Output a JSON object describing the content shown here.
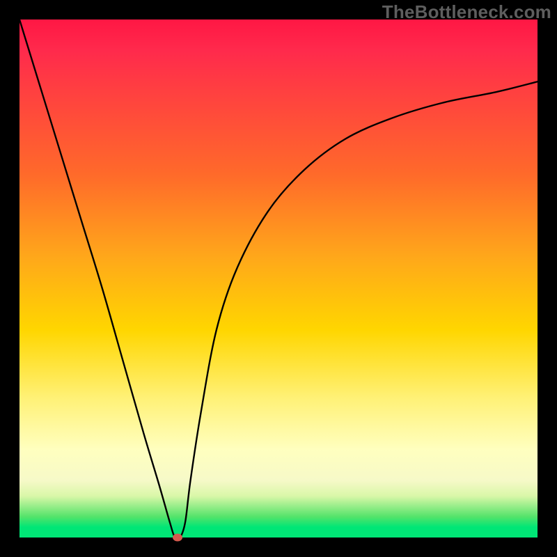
{
  "watermark": "TheBottleneck.com",
  "colors": {
    "frame": "#000000",
    "curve": "#000000",
    "marker": "#d65a4e",
    "gradient_stops": [
      "#ff1744",
      "#ff4040",
      "#ff6a2a",
      "#ffa81a",
      "#ffd600",
      "#fff176",
      "#ffffbf",
      "#d9f7a8",
      "#00e676"
    ]
  },
  "chart_data": {
    "type": "line",
    "title": "",
    "xlabel": "",
    "ylabel": "",
    "xlim": [
      0,
      100
    ],
    "ylim": [
      0,
      100
    ],
    "curve": {
      "x": [
        0,
        4,
        8,
        12,
        16,
        20,
        24,
        27,
        29,
        30,
        31,
        32,
        33,
        35,
        38,
        42,
        48,
        55,
        63,
        72,
        82,
        92,
        100
      ],
      "y": [
        100,
        87,
        74,
        61,
        48,
        34,
        20,
        10,
        3,
        0,
        0,
        3,
        11,
        24,
        40,
        52,
        63,
        71,
        77,
        81,
        84,
        86,
        88
      ]
    },
    "minimum_marker": {
      "x": 30.5,
      "y": 0
    },
    "annotations": []
  }
}
